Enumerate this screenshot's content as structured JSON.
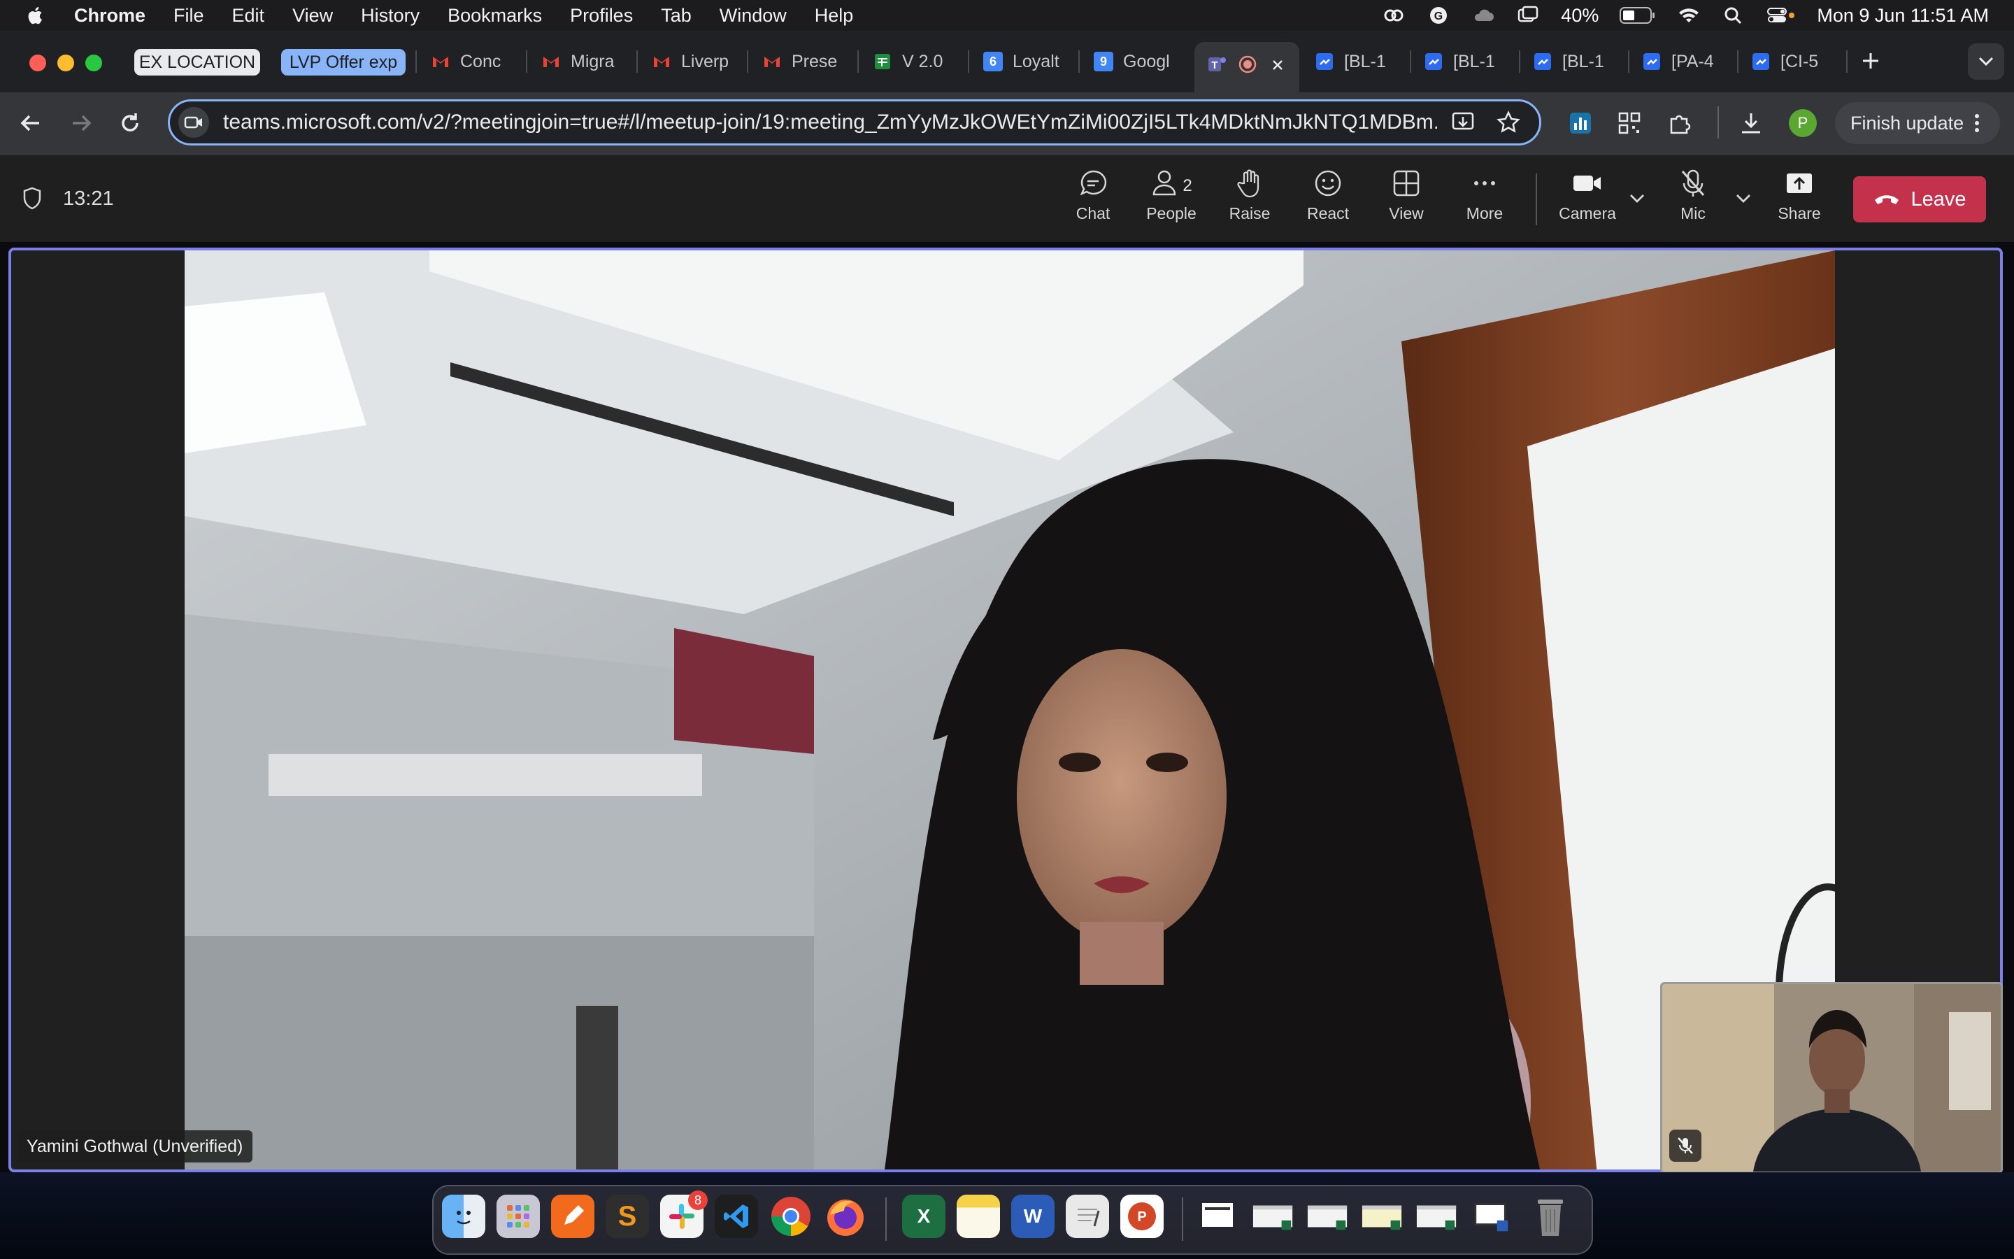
{
  "menubar": {
    "app": "Chrome",
    "items": [
      "File",
      "Edit",
      "View",
      "History",
      "Bookmarks",
      "Profiles",
      "Tab",
      "Window",
      "Help"
    ],
    "battery": "40%",
    "datetime": "Mon 9 Jun  11:51 AM"
  },
  "tabs": {
    "groups": [
      {
        "label": "EX LOCATION",
        "color": "#e8eaed",
        "text_color": "#202124"
      },
      {
        "label": "LVP Offer exp",
        "color": "#8ab4f8",
        "text_color": "#202124"
      }
    ],
    "items": [
      {
        "label": "Conc",
        "icon": "gmail-icon"
      },
      {
        "label": "Migra",
        "icon": "gmail-icon"
      },
      {
        "label": "Liverp",
        "icon": "gmail-icon"
      },
      {
        "label": "Prese",
        "icon": "gmail-icon"
      },
      {
        "label": "V 2.0",
        "icon": "sheets-icon"
      },
      {
        "label": "Loyalt",
        "icon": "calendar-icon"
      },
      {
        "label": "Googl",
        "icon": "calendar-icon"
      },
      {
        "label": "[BL-1",
        "icon": "jira-icon"
      },
      {
        "label": "[BL-1",
        "icon": "jira-icon"
      },
      {
        "label": "[BL-1",
        "icon": "jira-icon"
      },
      {
        "label": "[PA-4",
        "icon": "jira-icon"
      },
      {
        "label": "[CI-5",
        "icon": "jira-icon"
      }
    ],
    "calendar_day_a": "6",
    "calendar_day_b": "9"
  },
  "toolbar": {
    "url": "teams.microsoft.com/v2/?meetingjoin=true#/l/meetup-join/19:meeting_ZmYyMzJkOWEtYmZiMi00ZjI5LTk4MDktNmJkNTQ1MDBm...",
    "finish_update": "Finish update",
    "profile_initial": "P"
  },
  "meeting": {
    "timer": "13:21",
    "controls": {
      "chat": "Chat",
      "people": "People",
      "people_count": "2",
      "raise": "Raise",
      "react": "React",
      "view": "View",
      "more": "More",
      "camera": "Camera",
      "mic": "Mic",
      "share": "Share",
      "leave": "Leave"
    },
    "participant_name": "Yamini Gothwal (Unverified)"
  },
  "dock": {
    "slack_badge": "8"
  },
  "colors": {
    "accent": "#7b7fe6",
    "leave": "#c4314b",
    "omnibox_border": "#8ab4f8"
  }
}
